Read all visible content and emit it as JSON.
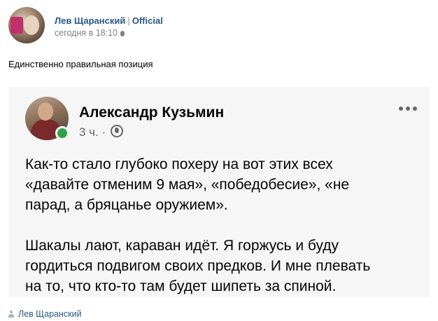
{
  "post": {
    "author": "Лев Щаранский",
    "separator": "|",
    "official_label": "Official",
    "date": "сегодня в 18:10",
    "date_icon": "apple-icon",
    "text": "Единственно правильная позиция",
    "signature": "Лев Щаранский",
    "signature_icon": "person-icon"
  },
  "embedded_post": {
    "author": "Александр Кузьмин",
    "time": "3 ч. ·",
    "privacy_icon": "globe-icon",
    "menu_icon": "more-icon",
    "online_status_color": "#31a24c",
    "paragraphs": [
      "Как-то стало глубоко похеру на вот этих всех\n«давайте отменим 9 мая», «победобесие», «не\nпарад, а бряцанье оружием».",
      "Шакалы лают, караван идёт. Я горжусь и буду\nгордиться подвигом своих предков. И мне плевать\nна то, что кто-то там будет шипеть за спиной."
    ]
  },
  "colors": {
    "link": "#2a5885",
    "muted": "#828282",
    "card_background": "#f6f6f6"
  }
}
